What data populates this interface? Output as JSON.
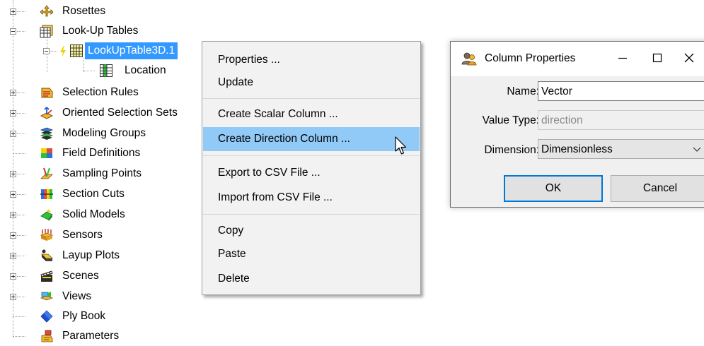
{
  "tree": {
    "items": [
      {
        "label": "Rosettes",
        "icon": "rosettes-icon"
      },
      {
        "label": "Look-Up Tables",
        "icon": "lookup-tables-icon"
      },
      {
        "label": "LookUpTable3D.1",
        "icon": "table-icon"
      },
      {
        "label": "Location",
        "icon": "table-column-icon"
      },
      {
        "label": "Selection Rules",
        "icon": "selection-rules-icon"
      },
      {
        "label": "Oriented Selection Sets",
        "icon": "oriented-selection-sets-icon"
      },
      {
        "label": "Modeling Groups",
        "icon": "modeling-groups-icon"
      },
      {
        "label": "Field Definitions",
        "icon": "field-definitions-icon"
      },
      {
        "label": "Sampling Points",
        "icon": "sampling-points-icon"
      },
      {
        "label": "Section Cuts",
        "icon": "section-cuts-icon"
      },
      {
        "label": "Solid Models",
        "icon": "solid-models-icon"
      },
      {
        "label": "Sensors",
        "icon": "sensors-icon"
      },
      {
        "label": "Layup Plots",
        "icon": "layup-plots-icon"
      },
      {
        "label": "Scenes",
        "icon": "scenes-icon"
      },
      {
        "label": "Views",
        "icon": "views-icon"
      },
      {
        "label": "Ply Book",
        "icon": "ply-book-icon"
      },
      {
        "label": "Parameters",
        "icon": "parameters-icon"
      }
    ]
  },
  "context_menu": {
    "items": [
      {
        "label": "Properties ..."
      },
      {
        "label": "Update"
      },
      {
        "label": "Create Scalar Column ..."
      },
      {
        "label": "Create Direction Column ..."
      },
      {
        "label": "Export to CSV File ..."
      },
      {
        "label": "Import from CSV File ..."
      },
      {
        "label": "Copy"
      },
      {
        "label": "Paste"
      },
      {
        "label": "Delete"
      }
    ]
  },
  "dialog": {
    "title": "Column Properties",
    "name_label": "Name:",
    "name_value": "Vector",
    "value_type_label": "Value Type:",
    "value_type_value": "direction",
    "dimension_label": "Dimension:",
    "dimension_value": "Dimensionless",
    "ok_label": "OK",
    "cancel_label": "Cancel"
  },
  "colors": {
    "selection": "#3399ff",
    "menu_hover": "#91c9f7",
    "menu_background": "#f2f2f2",
    "dialog_body": "#f0f0f0",
    "default_button_border": "#0078d7"
  }
}
